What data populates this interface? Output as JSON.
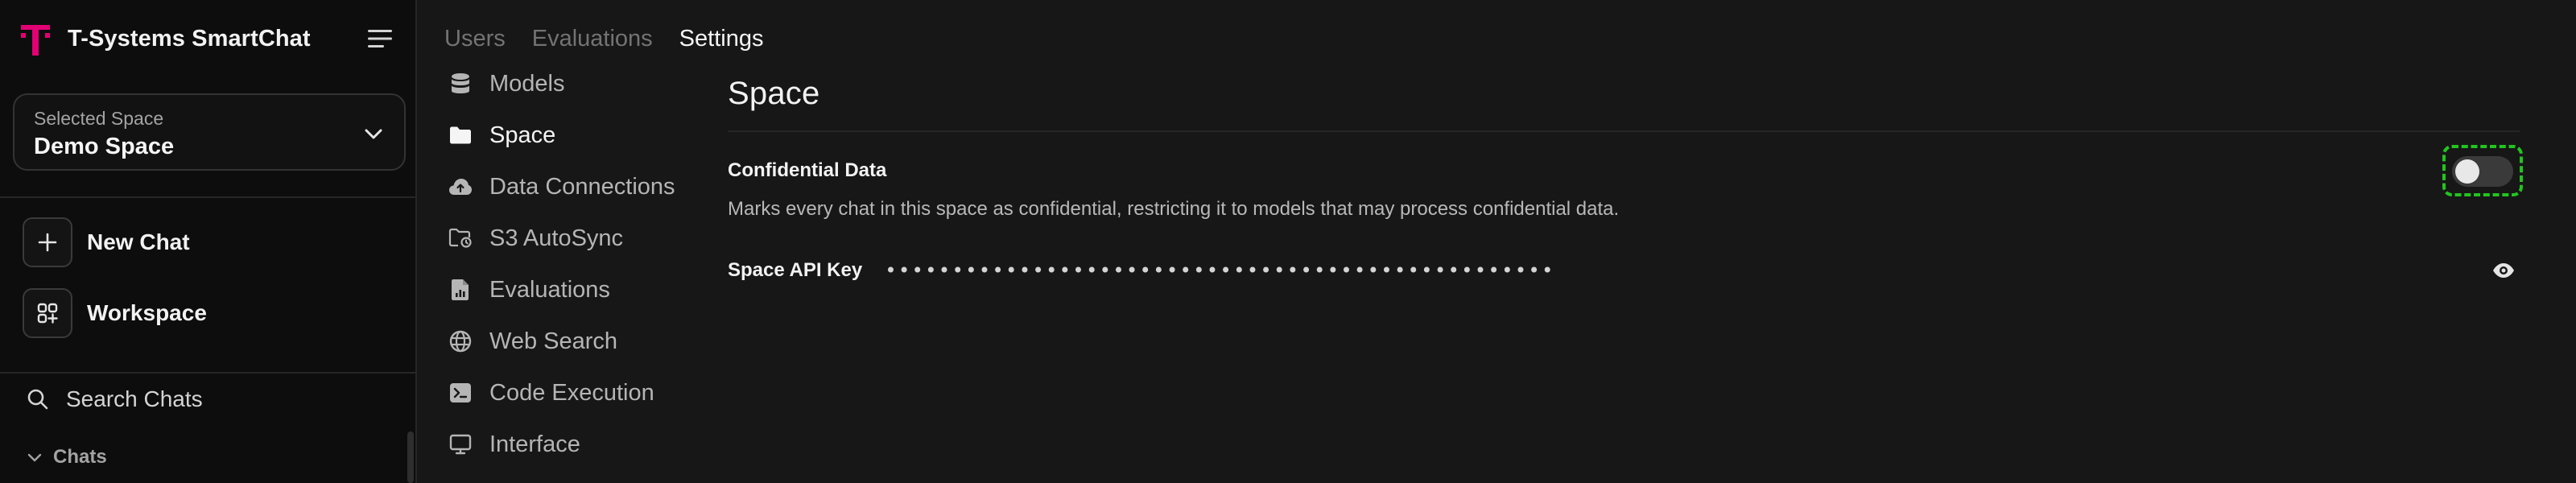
{
  "app": {
    "name": "T-Systems SmartChat",
    "brand_color": "#e20074"
  },
  "space_selector": {
    "label": "Selected Space",
    "value": "Demo Space"
  },
  "sidebar": {
    "actions": [
      {
        "label": "New Chat",
        "icon": "plus-icon"
      },
      {
        "label": "Workspace",
        "icon": "workspace-icon"
      }
    ],
    "search_label": "Search Chats",
    "chats_section_label": "Chats"
  },
  "tabs": [
    {
      "label": "Users",
      "active": false
    },
    {
      "label": "Evaluations",
      "active": false
    },
    {
      "label": "Settings",
      "active": true
    }
  ],
  "settings_nav": [
    {
      "label": "Models",
      "icon": "database-icon",
      "active": false
    },
    {
      "label": "Space",
      "icon": "folder-icon",
      "active": true
    },
    {
      "label": "Data Connections",
      "icon": "cloud-icon",
      "active": false
    },
    {
      "label": "S3 AutoSync",
      "icon": "folder-sync-icon",
      "active": false
    },
    {
      "label": "Evaluations",
      "icon": "document-icon",
      "active": false
    },
    {
      "label": "Web Search",
      "icon": "globe-icon",
      "active": false
    },
    {
      "label": "Code Execution",
      "icon": "terminal-icon",
      "active": false
    },
    {
      "label": "Interface",
      "icon": "monitor-icon",
      "active": false
    }
  ],
  "main": {
    "title": "Space",
    "confidential": {
      "title": "Confidential Data",
      "description": "Marks every chat in this space as confidential, restricting it to models that may process confidential data.",
      "enabled": false
    },
    "api_key": {
      "label": "Space API Key",
      "masked_value": "••••••••••••••••••••••••••••••••••••••••••••••••••"
    }
  },
  "colors": {
    "background": "#171717",
    "sidebar_background": "#0d0d0d",
    "highlight": "#22c51e"
  }
}
